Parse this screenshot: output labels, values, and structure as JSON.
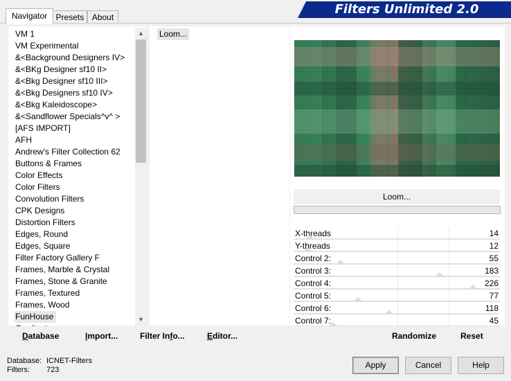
{
  "tabs": [
    {
      "label": "Navigator",
      "active": true
    },
    {
      "label": "Presets",
      "active": false
    },
    {
      "label": "About",
      "active": false
    }
  ],
  "banner_title": "Filters Unlimited 2.0",
  "categories": [
    "VM 1",
    "VM Experimental",
    "&<Background Designers IV>",
    "&<BKg Designer sf10 II>",
    "&<Bkg Designer sf10 III>",
    "&<Bkg Designers sf10 IV>",
    "&<Bkg Kaleidoscope>",
    "&<Sandflower Specials^v^ >",
    "[AFS IMPORT]",
    "AFH",
    "Andrew's Filter Collection 62",
    "Buttons & Frames",
    "Color Effects",
    "Color Filters",
    "Convolution Filters",
    "CPK Designs",
    "Distortion Filters",
    "Edges, Round",
    "Edges, Square",
    "Filter Factory Gallery F",
    "Frames, Marble & Crystal",
    "Frames, Stone & Granite",
    "Frames, Textured",
    "Frames, Wood",
    "FunHouse",
    "Gradients"
  ],
  "selected_category": "FunHouse",
  "filters": [
    "Loom..."
  ],
  "selected_filter": "Loom...",
  "filter_name": "Loom...",
  "controls": [
    {
      "label": "X-threads",
      "value": "14",
      "level": 0.055
    },
    {
      "label": "Y-threads",
      "value": "12",
      "level": 0.047
    },
    {
      "label": "Control 2:",
      "value": "55",
      "level": 0.216
    },
    {
      "label": "Control 3:",
      "value": "183",
      "level": 0.718
    },
    {
      "label": "Control 4:",
      "value": "226",
      "level": 0.886
    },
    {
      "label": "Control 5:",
      "value": "77",
      "level": 0.302
    },
    {
      "label": "Control 6:",
      "value": "118",
      "level": 0.463
    },
    {
      "label": "Control 7:",
      "value": "45",
      "level": 0.176
    }
  ],
  "bottom_left_buttons": [
    "Database",
    "Import...",
    "Filter Info...",
    "Editor..."
  ],
  "bottom_right_buttons": [
    "Randomize",
    "Reset"
  ],
  "status": {
    "database_label": "Database:",
    "database_value": "ICNET-Filters",
    "filters_label": "Filters:",
    "filters_value": "723"
  },
  "dialog_buttons": [
    "Apply",
    "Cancel",
    "Help"
  ],
  "colors": {
    "banner": "#0b2a8c",
    "preview_green": "#2f7a55",
    "preview_pink": "#c89a8e"
  }
}
